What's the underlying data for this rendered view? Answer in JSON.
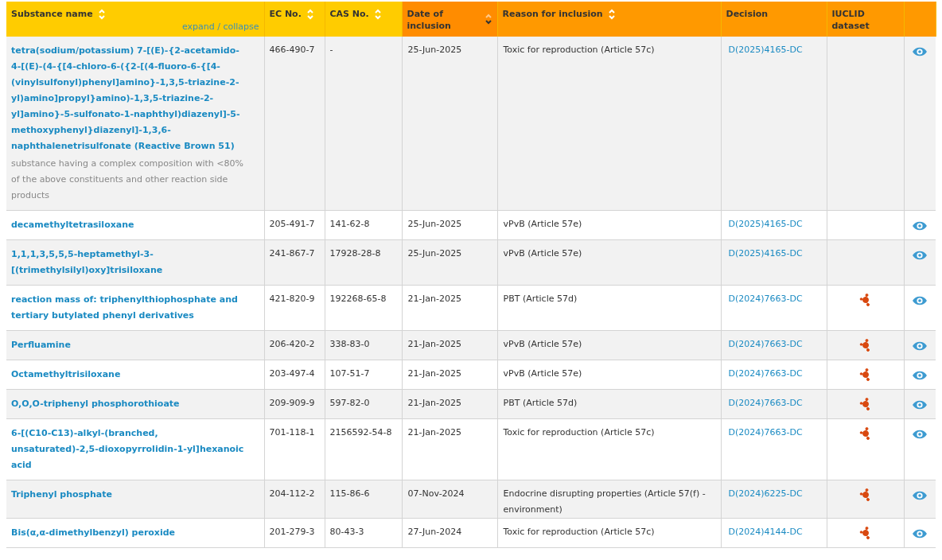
{
  "table": {
    "columns": [
      {
        "label": "Substance name",
        "sortable": true,
        "sorted": false,
        "link": "expand / collapse",
        "color": "#ffcc00"
      },
      {
        "label": "EC No.",
        "sortable": true,
        "sorted": false,
        "color": "#ffcc00"
      },
      {
        "label": "CAS No.",
        "sortable": true,
        "sorted": false,
        "color": "#ffcc00"
      },
      {
        "label": "Date of inclusion",
        "sortable": true,
        "sorted": true,
        "color": "#ff8c00"
      },
      {
        "label": "Reason for inclusion",
        "sortable": true,
        "sorted": false,
        "color": "#ff9900"
      },
      {
        "label": "Decision",
        "sortable": false,
        "color": "#ff9900"
      },
      {
        "label": "IUCLID dataset",
        "sortable": false,
        "color": "#ff9900"
      },
      {
        "sortable": false,
        "color": "#ff9900"
      }
    ],
    "rows": [
      {
        "name": "tetra(sodium/potassium) 7-[(E)-{2-acetamido-4-[(E)-(4-{[4-chloro-6-({2-[(4-fluoro-6-{[4-(vinylsulfonyl)phenyl]amino}-1,3,5-triazine-2-yl)amino]propyl}amino)-1,3,5-triazine-2-yl]amino}-5-sulfonato-1-naphthyl)diazenyl]-5-methoxyphenyl}diazenyl]-1,3,6-naphthalenetrisulfonate (Reactive Brown 51)",
        "note": "substance having a complex composition with <80% of the above constituents and other reaction side products",
        "ec": "466-490-7",
        "cas": "-",
        "date": "25-Jun-2025",
        "reason": "Toxic for reproduction (Article 57c)",
        "decision": "D(2025)4165-DC",
        "iuclid": false
      },
      {
        "name": "decamethyltetrasiloxane",
        "ec": "205-491-7",
        "cas": "141-62-8",
        "date": "25-Jun-2025",
        "reason": "vPvB (Article 57e)",
        "decision": "D(2025)4165-DC",
        "iuclid": false
      },
      {
        "name": "1,1,1,3,5,5,5-heptamethyl-3-[(trimethylsilyl)oxy]trisiloxane",
        "ec": "241-867-7",
        "cas": "17928-28-8",
        "date": "25-Jun-2025",
        "reason": "vPvB (Article 57e)",
        "decision": "D(2025)4165-DC",
        "iuclid": false
      },
      {
        "name": "reaction mass of: triphenylthiophosphate and tertiary butylated phenyl derivatives",
        "ec": "421-820-9",
        "cas": "192268-65-8",
        "date": "21-Jan-2025",
        "reason": "PBT (Article 57d)",
        "decision": "D(2024)7663-DC",
        "iuclid": true
      },
      {
        "name": "Perfluamine",
        "ec": "206-420-2",
        "cas": "338-83-0",
        "date": "21-Jan-2025",
        "reason": "vPvB (Article 57e)",
        "decision": "D(2024)7663-DC",
        "iuclid": true
      },
      {
        "name": "Octamethyltrisiloxane",
        "ec": "203-497-4",
        "cas": "107-51-7",
        "date": "21-Jan-2025",
        "reason": "vPvB (Article 57e)",
        "decision": "D(2024)7663-DC",
        "iuclid": true
      },
      {
        "name": "O,O,O-triphenyl phosphorothioate",
        "ec": "209-909-9",
        "cas": "597-82-0",
        "date": "21-Jan-2025",
        "reason": "PBT (Article 57d)",
        "decision": "D(2024)7663-DC",
        "iuclid": true
      },
      {
        "name": "6-[(C10-C13)-alkyl-(branched, unsaturated)-2,5-dioxopyrrolidin-1-yl]hexanoic acid",
        "ec": "701-118-1",
        "cas": "2156592-54-8",
        "date": "21-Jan-2025",
        "reason": "Toxic for reproduction (Article 57c)",
        "decision": "D(2024)7663-DC",
        "iuclid": true
      },
      {
        "name": "Triphenyl phosphate",
        "ec": "204-112-2",
        "cas": "115-86-6",
        "date": "07-Nov-2024",
        "reason": "Endocrine disrupting properties (Article 57(f) - environment)",
        "decision": "D(2024)6225-DC",
        "iuclid": true
      },
      {
        "name": "Bis(α,α-dimethylbenzyl) peroxide",
        "ec": "201-279-3",
        "cas": "80-43-3",
        "date": "27-Jun-2024",
        "reason": "Toxic for reproduction (Article 57c)",
        "decision": "D(2024)4144-DC",
        "iuclid": true
      }
    ]
  }
}
